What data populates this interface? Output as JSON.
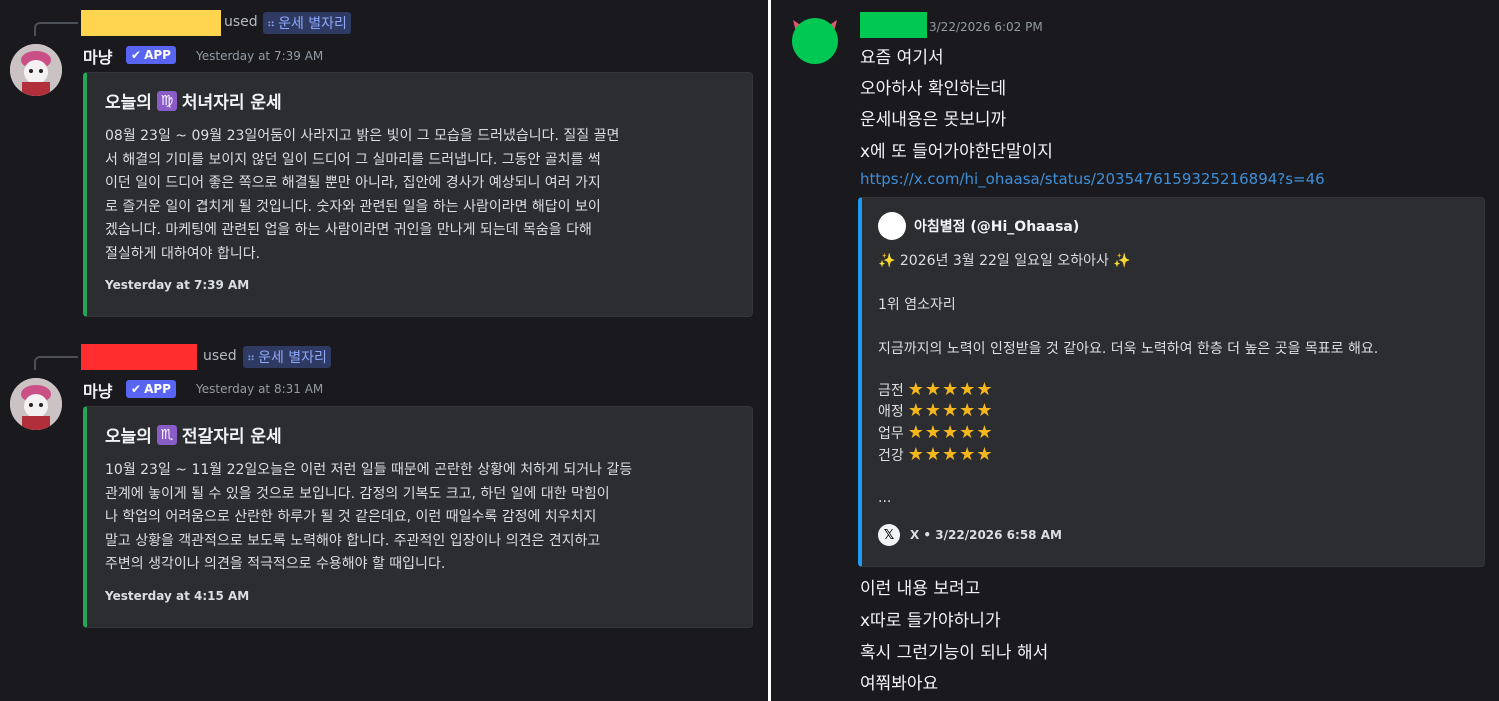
{
  "left": {
    "messages": [
      {
        "used_label": "used",
        "command": "운세 별자리",
        "redact_color": "#ffd54f",
        "bot_name": "마냥",
        "app_badge": "APP",
        "timestamp": "Yesterday at 7:39 AM",
        "embed": {
          "title_prefix": "오늘의",
          "zodiac_symbol": "♍",
          "title_suffix": "처녀자리 운세",
          "body": "08월 23일 ~ 09월 23일어둠이 사라지고 밝은 빛이 그 모습을 드러냈습니다. 질질 끌면\n서 해결의 기미를 보이지 않던 일이 드디어 그 실마리를 드러냅니다. 그동안 골치를 썩\n이던 일이 드디어 좋은 쪽으로 해결될 뿐만 아니라, 집안에 경사가 예상되니 여러 가지\n로 즐거운 일이 겹치게 될 것입니다. 숫자와 관련된 일을 하는 사람이라면 해답이 보이\n겠습니다. 마케팅에 관련된 업을 하는 사람이라면 귀인을 만나게 되는데 목숨을 다해\n절실하게 대하여야 합니다.",
          "footer": "Yesterday at 7:39 AM"
        }
      },
      {
        "used_label": "used",
        "command": "운세 별자리",
        "redact_color": "#ff2d2d",
        "bot_name": "마냥",
        "app_badge": "APP",
        "timestamp": "Yesterday at 8:31 AM",
        "embed": {
          "title_prefix": "오늘의",
          "zodiac_symbol": "♏",
          "title_suffix": "전갈자리 운세",
          "body": "10월 23일 ~ 11월 22일오늘은 이런 저런 일들 때문에 곤란한 상황에 처하게 되거나 갈등\n관계에 놓이게 될 수 있을 것으로 보입니다. 감정의 기복도 크고, 하던 일에 대한 막힘이\n나 학업의 어려움으로 산란한 하루가 될 것 같은데요, 이런 때일수록 감정에 치우치지\n말고 상황을 객관적으로 보도록 노력해야 합니다. 주관적인 입장이나 의견은 견지하고\n주변의 생각이나 의견을 적극적으로 수용해야 할 때입니다.",
          "footer": "Yesterday at 4:15 AM"
        }
      }
    ]
  },
  "right": {
    "timestamp": "3/22/2026 6:02 PM",
    "lines_before": [
      "요즘 여기서",
      "오아하사 확인하는데",
      "운세내용은 못보니까",
      "x에 또 들어가야한단말이지"
    ],
    "link": "https://x.com/hi_ohaasa/status/2035476159325216894?s=46",
    "embed": {
      "author": "아침별점 (@Hi_Ohaasa)",
      "date_line": "✨ 2026년 3월 22일 일요일 오하아사 ✨",
      "rank_line": "1위 염소자리",
      "message": "지금까지의 노력이 인정받을 것 같아요. 더욱 노력하여 한층 더 높은 곳을 목표로 해요.",
      "ratings": [
        {
          "label": "금전",
          "stars": 5
        },
        {
          "label": "애정",
          "stars": 5
        },
        {
          "label": "업무",
          "stars": 5
        },
        {
          "label": "건강",
          "stars": 5
        }
      ],
      "stars_text": "★★★★★",
      "ellipsis": "...",
      "footer": "X • 3/22/2026 6:58 AM",
      "x_icon": "𝕏"
    },
    "lines_after": [
      "이런 내용 보려고",
      "x따로 들가야하니가",
      "혹시 그런기능이 되나 해서",
      "여쭤봐아요"
    ]
  }
}
